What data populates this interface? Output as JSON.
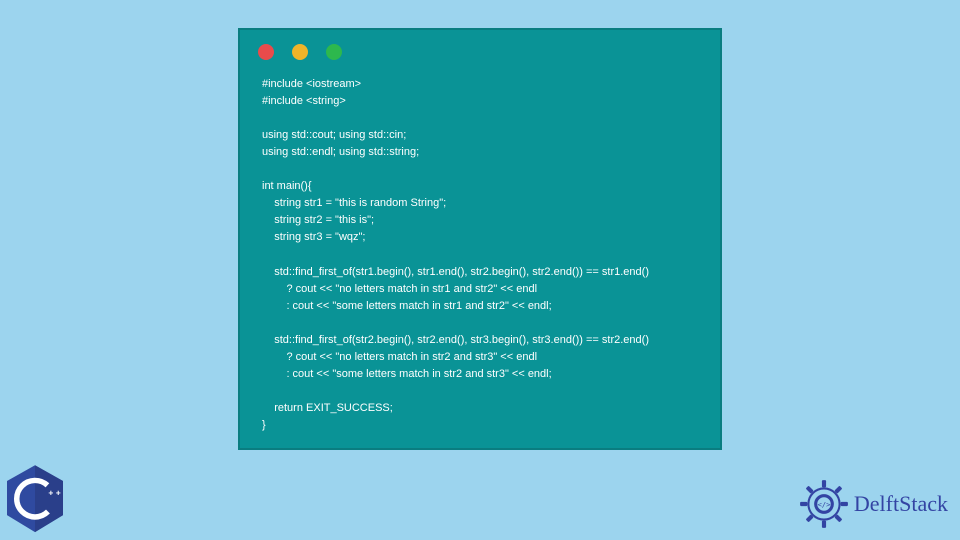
{
  "code": {
    "lines": [
      "#include <iostream>",
      "#include <string>",
      "",
      "using std::cout; using std::cin;",
      "using std::endl; using std::string;",
      "",
      "int main(){",
      "    string str1 = \"this is random String\";",
      "    string str2 = \"this is\";",
      "    string str3 = \"wqz\";",
      "",
      "    std::find_first_of(str1.begin(), str1.end(), str2.begin(), str2.end()) == str1.end()",
      "        ? cout << \"no letters match in str1 and str2\" << endl",
      "        : cout << \"some letters match in str1 and str2\" << endl;",
      "",
      "    std::find_first_of(str2.begin(), str2.end(), str3.begin(), str3.end()) == str2.end()",
      "        ? cout << \"no letters match in str2 and str3\" << endl",
      "        : cout << \"some letters match in str2 and str3\" << endl;",
      "",
      "    return EXIT_SUCCESS;",
      "}"
    ]
  },
  "badges": {
    "cpp_label": "C++",
    "brand_name": "DelftStack"
  },
  "colors": {
    "page_bg": "#9cd4ee",
    "window_bg": "#0a9396",
    "code_text": "#ffffff",
    "brand_text": "#3344a3"
  }
}
